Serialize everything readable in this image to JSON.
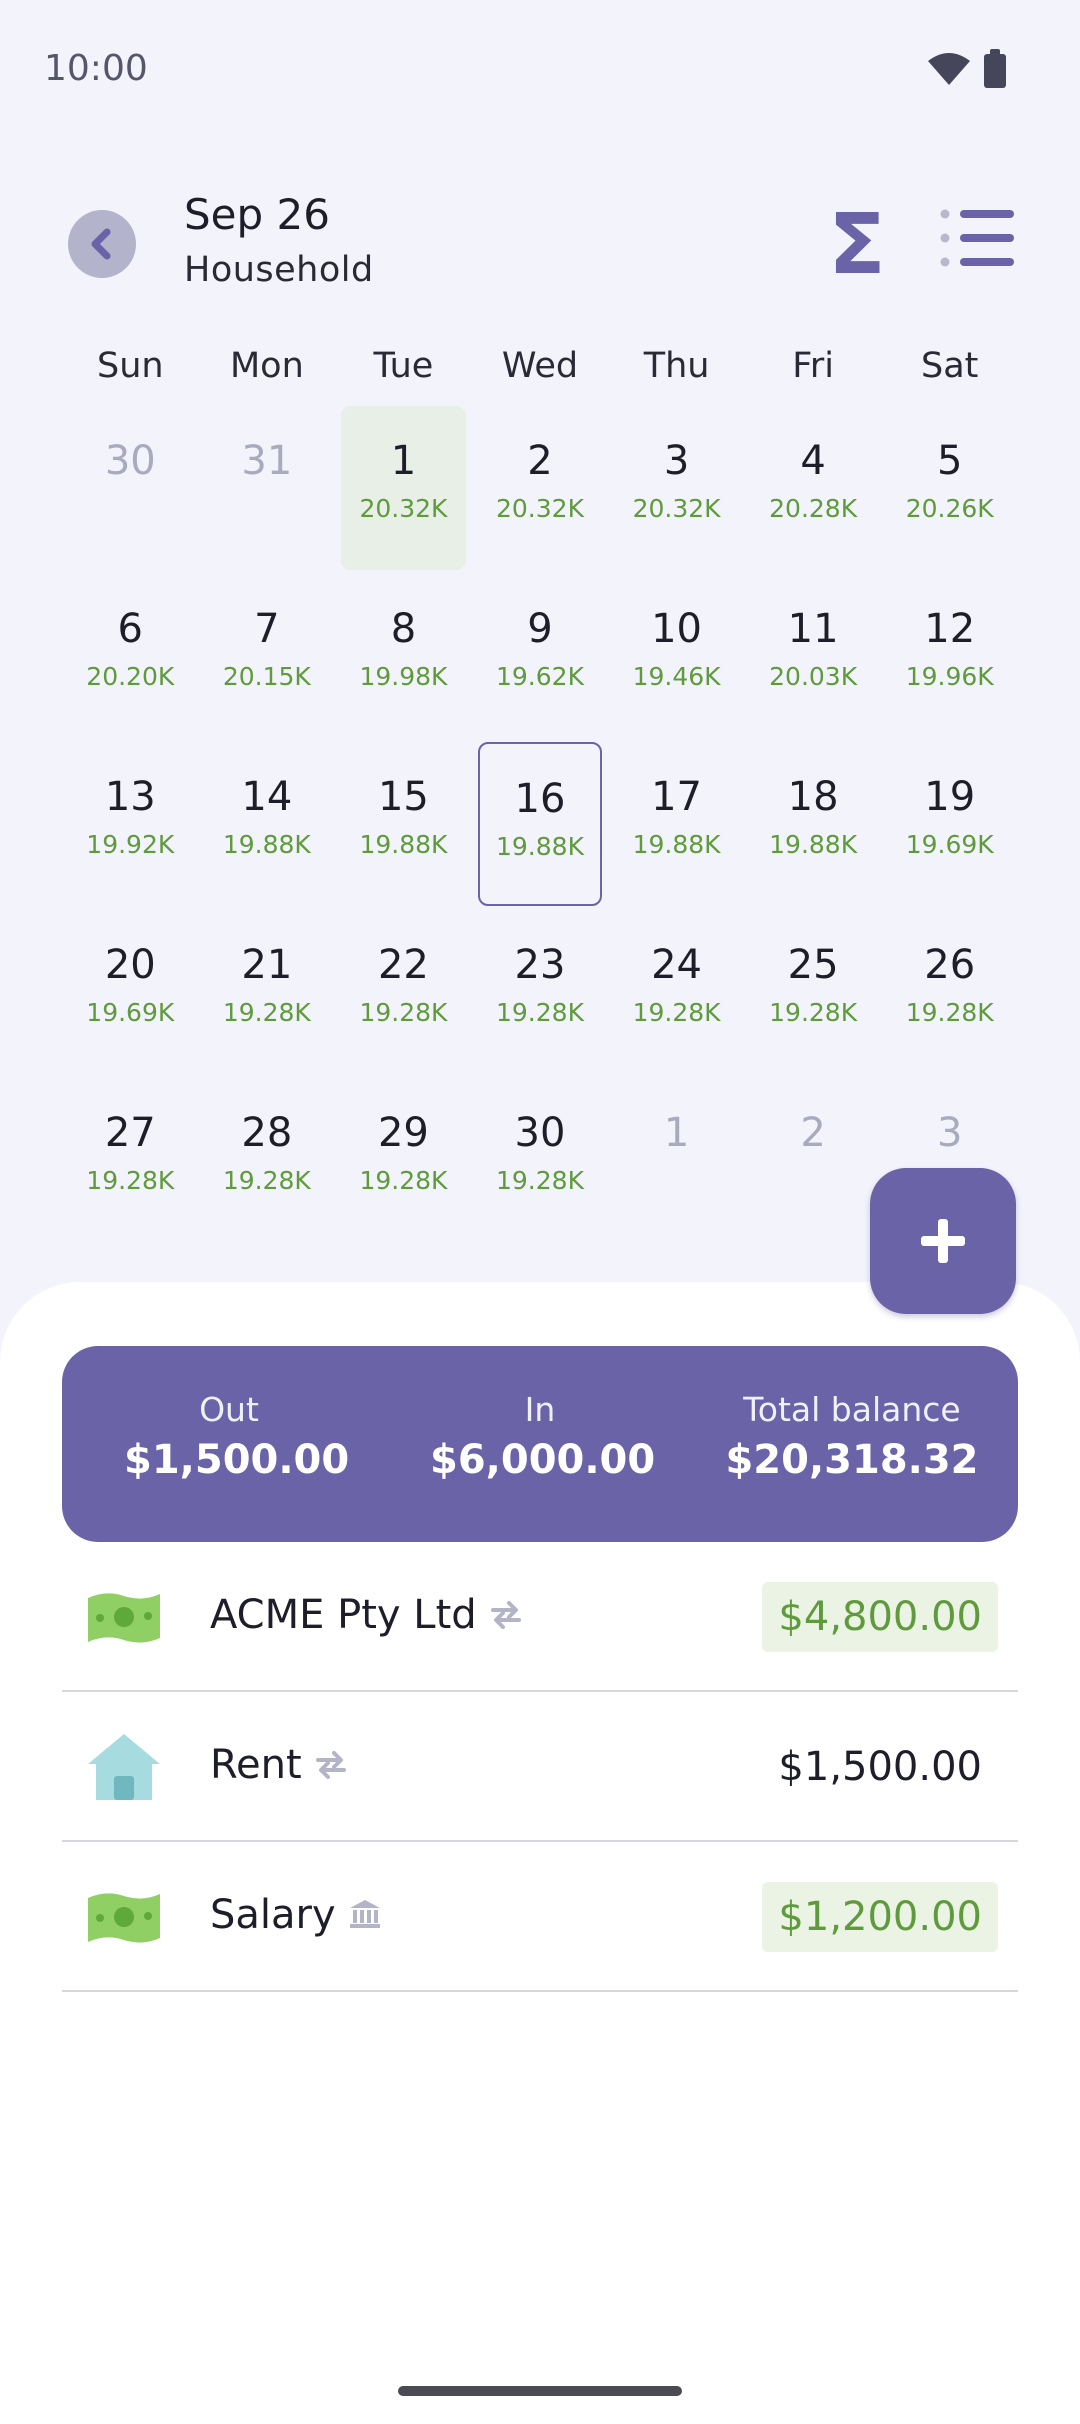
{
  "status": {
    "time": "10:00"
  },
  "header": {
    "date": "Sep 26",
    "account": "Household",
    "sigma_symbol": "Σ"
  },
  "weekdays": [
    "Sun",
    "Mon",
    "Tue",
    "Wed",
    "Thu",
    "Fri",
    "Sat"
  ],
  "days": [
    {
      "n": "30",
      "bal": "",
      "muted": true
    },
    {
      "n": "31",
      "bal": "",
      "muted": true
    },
    {
      "n": "1",
      "bal": "20.32K",
      "today": true
    },
    {
      "n": "2",
      "bal": "20.32K"
    },
    {
      "n": "3",
      "bal": "20.32K"
    },
    {
      "n": "4",
      "bal": "20.28K"
    },
    {
      "n": "5",
      "bal": "20.26K"
    },
    {
      "n": "6",
      "bal": "20.20K"
    },
    {
      "n": "7",
      "bal": "20.15K"
    },
    {
      "n": "8",
      "bal": "19.98K"
    },
    {
      "n": "9",
      "bal": "19.62K"
    },
    {
      "n": "10",
      "bal": "19.46K"
    },
    {
      "n": "11",
      "bal": "20.03K"
    },
    {
      "n": "12",
      "bal": "19.96K"
    },
    {
      "n": "13",
      "bal": "19.92K"
    },
    {
      "n": "14",
      "bal": "19.88K"
    },
    {
      "n": "15",
      "bal": "19.88K"
    },
    {
      "n": "16",
      "bal": "19.88K",
      "selected": true
    },
    {
      "n": "17",
      "bal": "19.88K"
    },
    {
      "n": "18",
      "bal": "19.88K"
    },
    {
      "n": "19",
      "bal": "19.69K"
    },
    {
      "n": "20",
      "bal": "19.69K"
    },
    {
      "n": "21",
      "bal": "19.28K"
    },
    {
      "n": "22",
      "bal": "19.28K"
    },
    {
      "n": "23",
      "bal": "19.28K"
    },
    {
      "n": "24",
      "bal": "19.28K"
    },
    {
      "n": "25",
      "bal": "19.28K"
    },
    {
      "n": "26",
      "bal": "19.28K"
    },
    {
      "n": "27",
      "bal": "19.28K"
    },
    {
      "n": "28",
      "bal": "19.28K"
    },
    {
      "n": "29",
      "bal": "19.28K"
    },
    {
      "n": "30",
      "bal": "19.28K"
    },
    {
      "n": "1",
      "bal": "",
      "muted": true
    },
    {
      "n": "2",
      "bal": "",
      "muted": true
    },
    {
      "n": "3",
      "bal": "",
      "muted": true
    }
  ],
  "summary": {
    "out_label": "Out",
    "out_value": "$1,500.00",
    "in_label": "In",
    "in_value": "$6,000.00",
    "total_label": "Total balance",
    "total_value": "$20,318.32"
  },
  "transactions": [
    {
      "name": "ACME Pty Ltd",
      "icon": "money-icon",
      "tag": "repeat-icon",
      "amount": "$4,800.00",
      "income": true
    },
    {
      "name": "Rent",
      "icon": "house-icon",
      "tag": "repeat-icon",
      "amount": "$1,500.00",
      "income": false
    },
    {
      "name": "Salary",
      "icon": "money-icon",
      "tag": "bank-icon",
      "amount": "$1,200.00",
      "income": true
    }
  ],
  "colors": {
    "accent": "#6b63a8",
    "income_green": "#5f9b3c",
    "income_bg": "#eaf3e4",
    "today_bg": "#e8efe6",
    "background": "#f3f3fb"
  }
}
